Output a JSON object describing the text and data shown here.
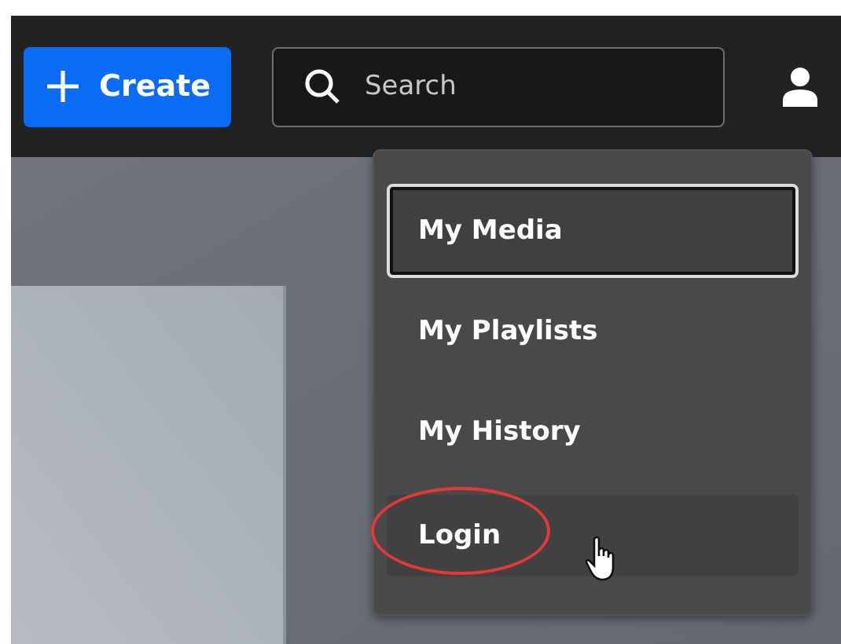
{
  "header": {
    "create_button": {
      "label": "Create"
    },
    "search": {
      "placeholder": "Search"
    }
  },
  "user_menu": {
    "items": [
      {
        "label": "My Media",
        "selected": true,
        "hovered": false,
        "circled": false
      },
      {
        "label": "My Playlists",
        "selected": false,
        "hovered": false,
        "circled": false
      },
      {
        "label": "My History",
        "selected": false,
        "hovered": false,
        "circled": false
      },
      {
        "label": "Login",
        "selected": false,
        "hovered": true,
        "circled": true
      }
    ]
  }
}
